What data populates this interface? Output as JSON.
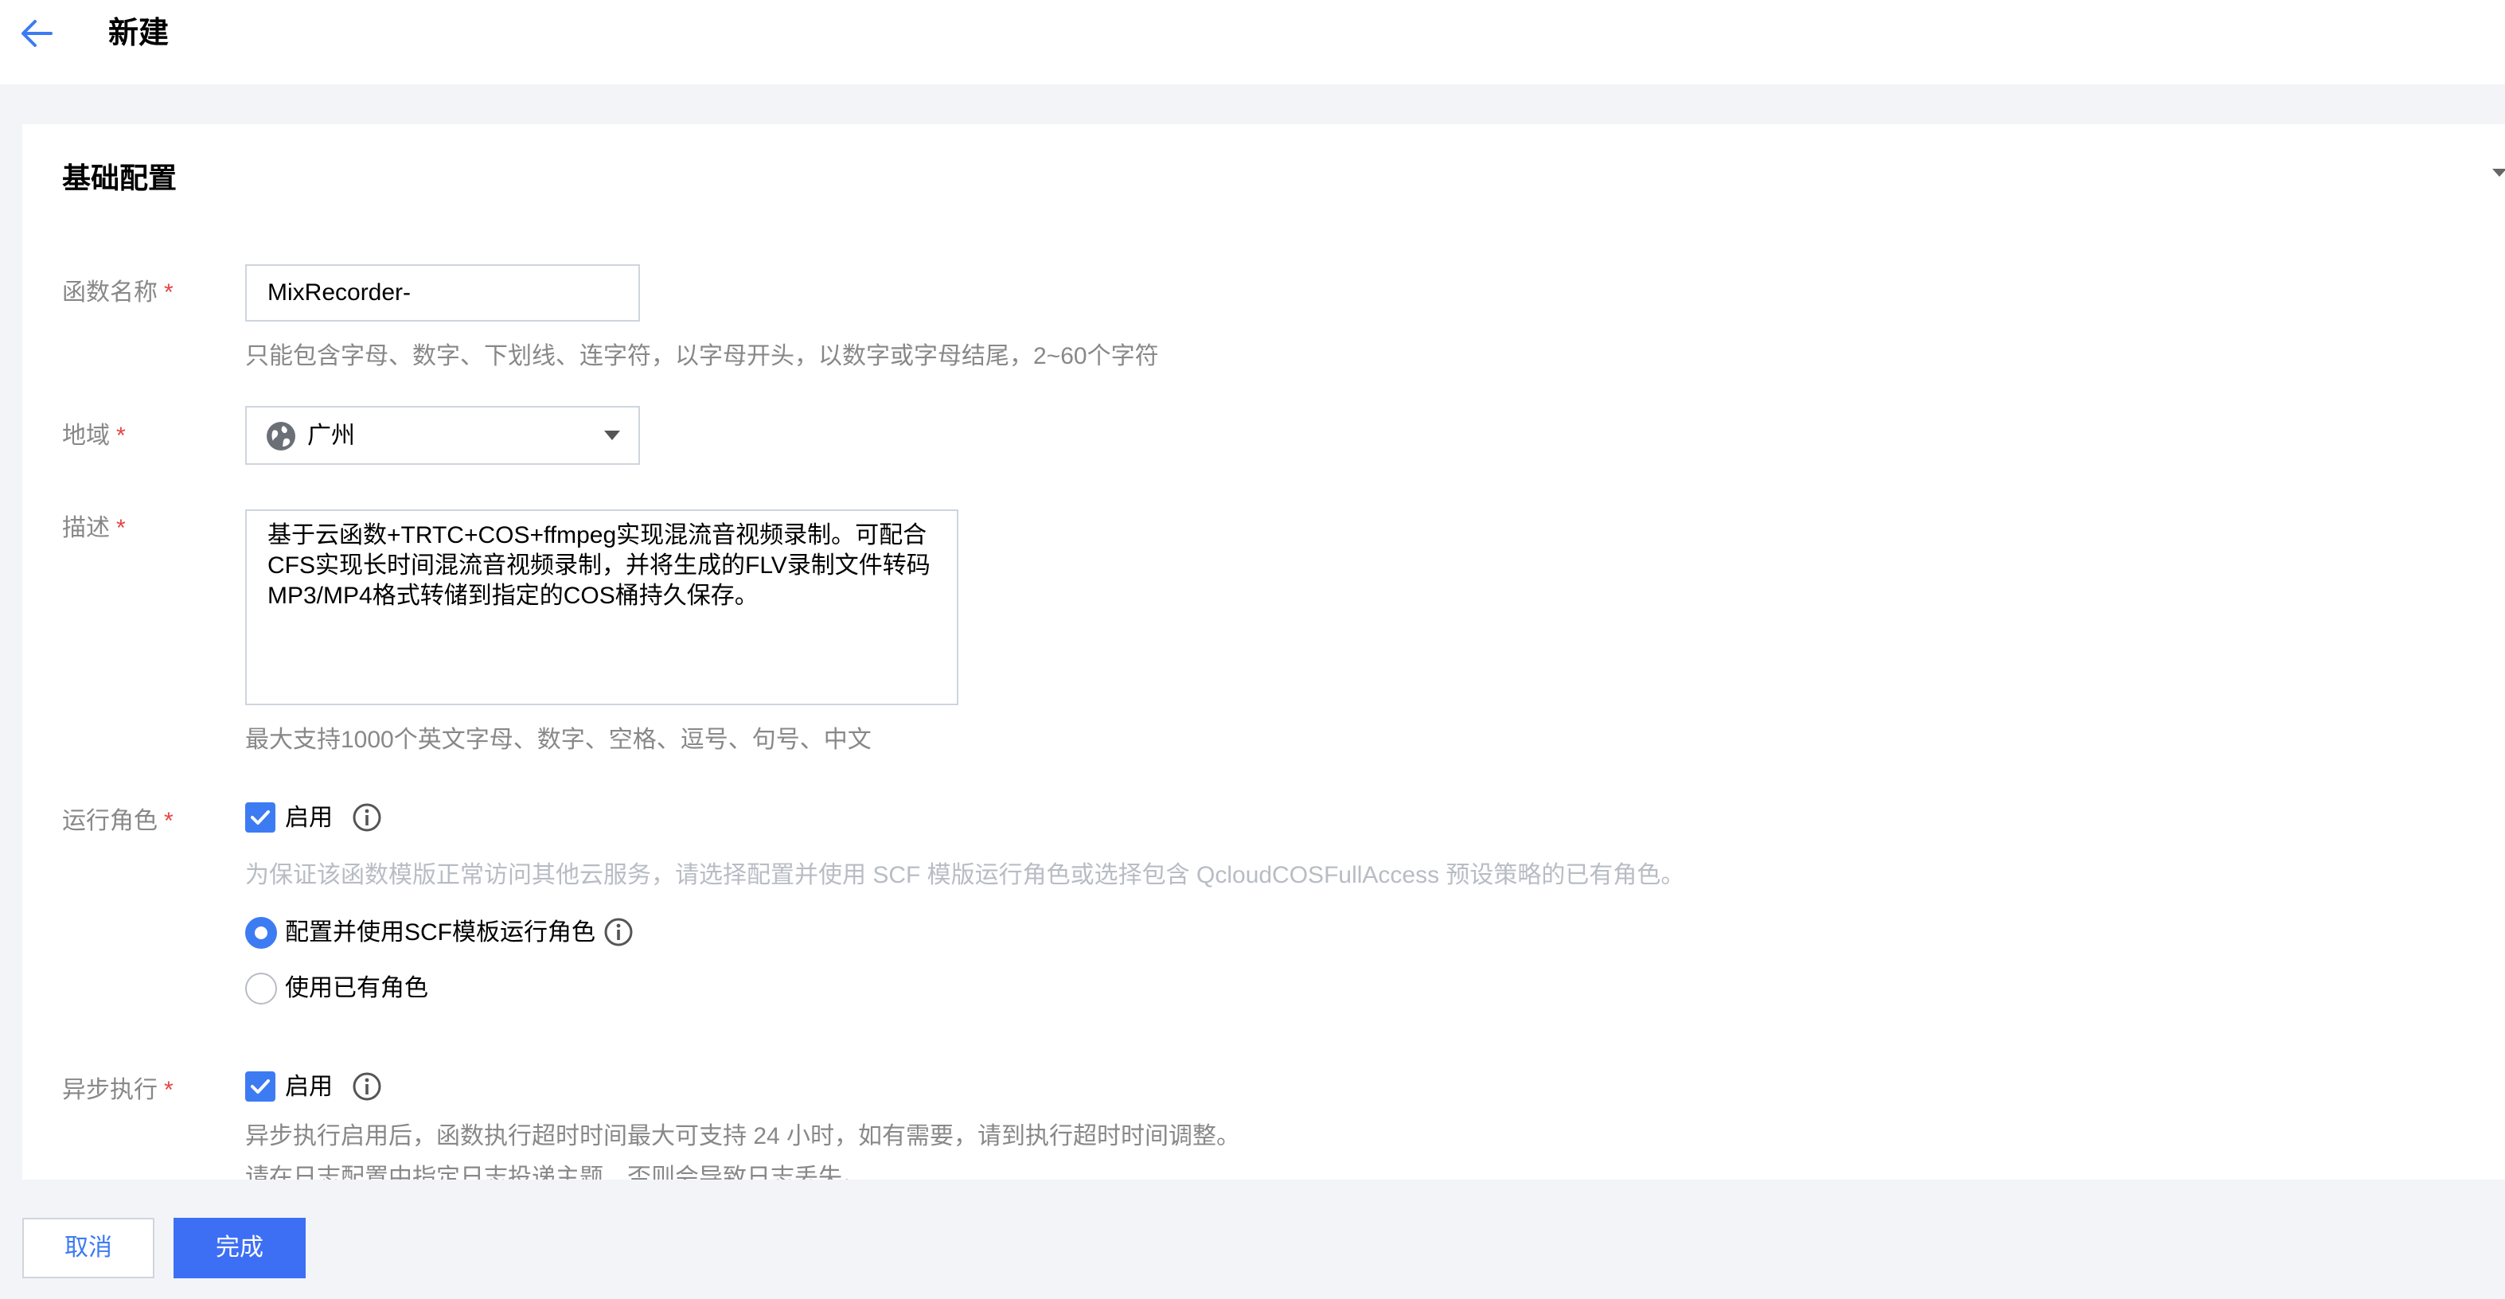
{
  "header": {
    "title": "新建"
  },
  "section": {
    "title": "基础配置"
  },
  "required_mark": "*",
  "function_name": {
    "label": "函数名称",
    "value": "MixRecorder-",
    "hint": "只能包含字母、数字、下划线、连字符，以字母开头，以数字或字母结尾，2~60个字符"
  },
  "region": {
    "label": "地域",
    "value": "广州"
  },
  "description": {
    "label": "描述",
    "value": "基于云函数+TRTC+COS+ffmpeg实现混流音视频录制。可配合CFS实现长时间混流音视频录制，并将生成的FLV录制文件转码MP3/MP4格式转储到指定的COS桶持久保存。",
    "hint": "最大支持1000个英文字母、数字、空格、逗号、句号、中文"
  },
  "run_role": {
    "label": "运行角色",
    "checkbox_label": "启用",
    "checked": true,
    "hint": "为保证该函数模版正常访问其他云服务，请选择配置并使用 SCF 模版运行角色或选择包含 QcloudCOSFullAccess 预设策略的已有角色。",
    "options": [
      {
        "label": "配置并使用SCF模板运行角色",
        "selected": true
      },
      {
        "label": "使用已有角色",
        "selected": false
      }
    ]
  },
  "async_exec": {
    "label": "异步执行",
    "checkbox_label": "启用",
    "checked": true,
    "hint": "异步执行启用后，函数执行超时时间最大可支持 24 小时，如有需要，请到执行超时时间调整。",
    "hint2": "请在日志配置中指定日志投递主题，否则会导致日志丢失。"
  },
  "footer": {
    "cancel_label": "取消",
    "confirm_label": "完成"
  },
  "colors": {
    "primary": "#3d7bf3",
    "required": "#e54545",
    "hint": "#888888",
    "border": "#cfd5de"
  }
}
